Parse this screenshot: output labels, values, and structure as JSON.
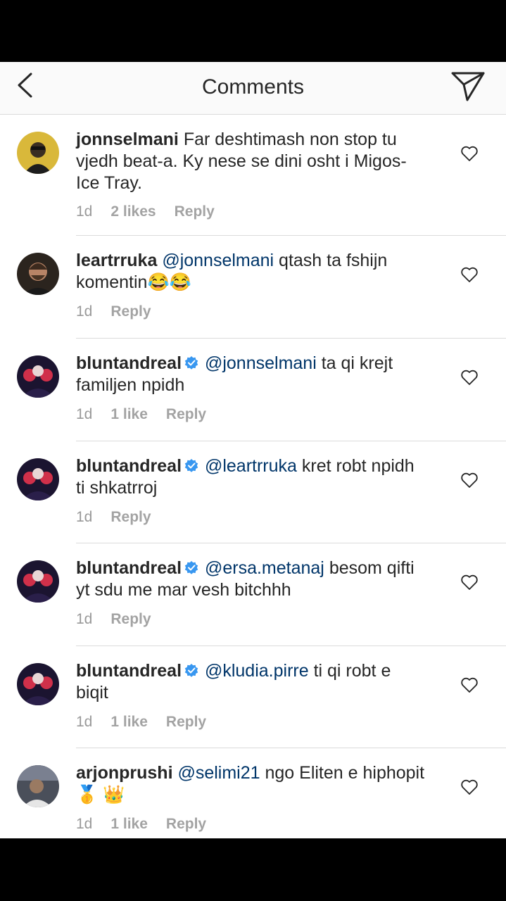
{
  "header": {
    "title": "Comments"
  },
  "comments": [
    {
      "username": "jonnselmani",
      "verified": false,
      "mention": "",
      "text": " Far deshtimash non stop tu vjedh beat-a. Ky nese se dini osht i Migos-Ice Tray.",
      "time": "1d",
      "likes": "2 likes",
      "reply": "Reply"
    },
    {
      "username": "leartrruka",
      "verified": false,
      "mention": "@jonnselmani",
      "text": " qtash ta fshijn komentin😂😂",
      "time": "1d",
      "likes": "",
      "reply": "Reply"
    },
    {
      "username": "bluntandreal",
      "verified": true,
      "mention": "@jonnselmani",
      "text": " ta qi krejt familjen npidh",
      "time": "1d",
      "likes": "1 like",
      "reply": "Reply"
    },
    {
      "username": "bluntandreal",
      "verified": true,
      "mention": "@leartrruka",
      "text": " kret robt npidh ti shkatrroj",
      "time": "1d",
      "likes": "",
      "reply": "Reply"
    },
    {
      "username": "bluntandreal",
      "verified": true,
      "mention": "@ersa.metanaj",
      "text": " besom qifti yt sdu me mar vesh bitchhh",
      "time": "1d",
      "likes": "",
      "reply": "Reply"
    },
    {
      "username": "bluntandreal",
      "verified": true,
      "mention": "@kludia.pirre",
      "text": " ti qi robt e biqit",
      "time": "1d",
      "likes": "1 like",
      "reply": "Reply"
    },
    {
      "username": "arjonprushi",
      "verified": false,
      "mention": "@selimi21",
      "text": "  ngo Eliten e hiphopit 🥇 👑",
      "time": "1d",
      "likes": "1 like",
      "reply": "Reply"
    }
  ],
  "icons": {
    "back": "chevron-left-icon",
    "send": "paper-plane-icon",
    "like": "heart-outline-icon",
    "verified": "verified-badge-icon"
  },
  "colors": {
    "mention": "#003569",
    "verified": "#3897f0",
    "meta": "#999999"
  }
}
